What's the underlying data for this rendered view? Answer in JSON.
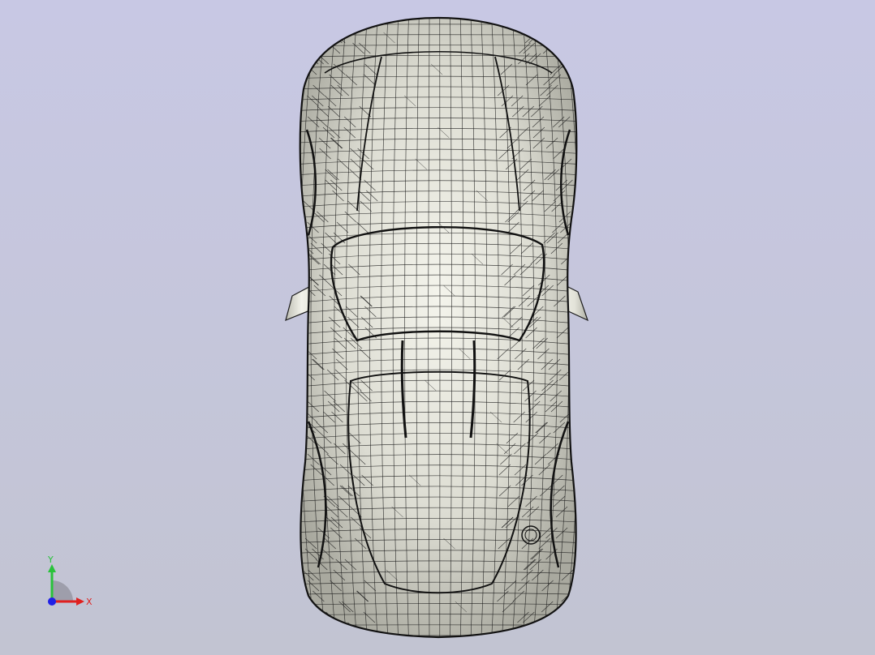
{
  "viewport": {
    "background_top": "#c8c8e4",
    "background_bottom": "#c2c4d2",
    "model": {
      "fill_color": "#e7e7dd",
      "mesh_color": "#1a1a1a"
    }
  },
  "triad": {
    "x_label": "X",
    "y_label": "Y",
    "x_color": "#e0201f",
    "y_color": "#29c23b",
    "z_color": "#2020e6"
  }
}
